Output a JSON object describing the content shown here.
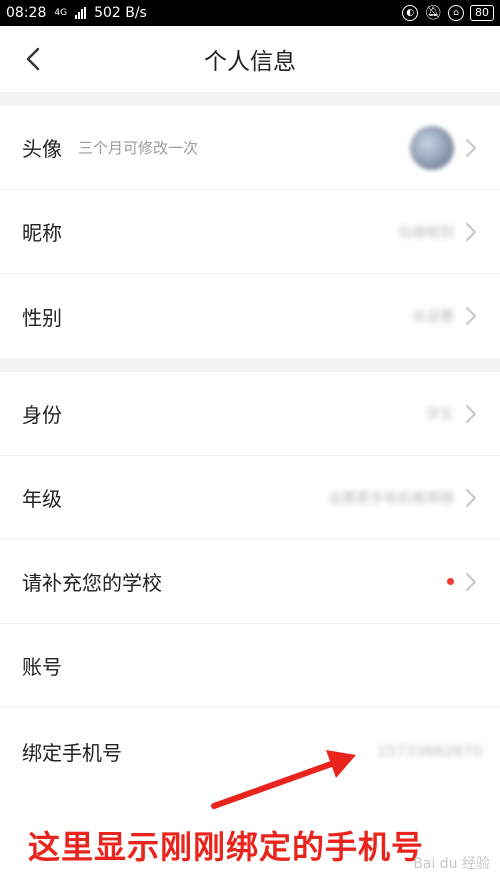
{
  "status_bar": {
    "time": "08:28",
    "network_label": "4G",
    "speed": "502 B/s",
    "battery": "80"
  },
  "header": {
    "title": "个人信息"
  },
  "groups": [
    {
      "rows": [
        {
          "label": "头像",
          "hint": "三个月可修改一次",
          "type": "avatar"
        },
        {
          "label": "昵称",
          "value": "仙缘帐别",
          "type": "value"
        },
        {
          "label": "性别",
          "value": "未设置",
          "type": "value"
        }
      ]
    },
    {
      "rows": [
        {
          "label": "身份",
          "value": "学生",
          "type": "value"
        },
        {
          "label": "年级",
          "value": "设置更多有机推荐精",
          "type": "value"
        },
        {
          "label": "请补充您的学校",
          "type": "dot"
        },
        {
          "label": "账号",
          "type": "none"
        },
        {
          "label": "绑定手机号",
          "value": "15733662670",
          "type": "phone"
        }
      ]
    }
  ],
  "annotation": {
    "text": "这里显示刚刚绑定的手机号",
    "color": "#e8241c"
  },
  "watermark": "Bai du 经验"
}
